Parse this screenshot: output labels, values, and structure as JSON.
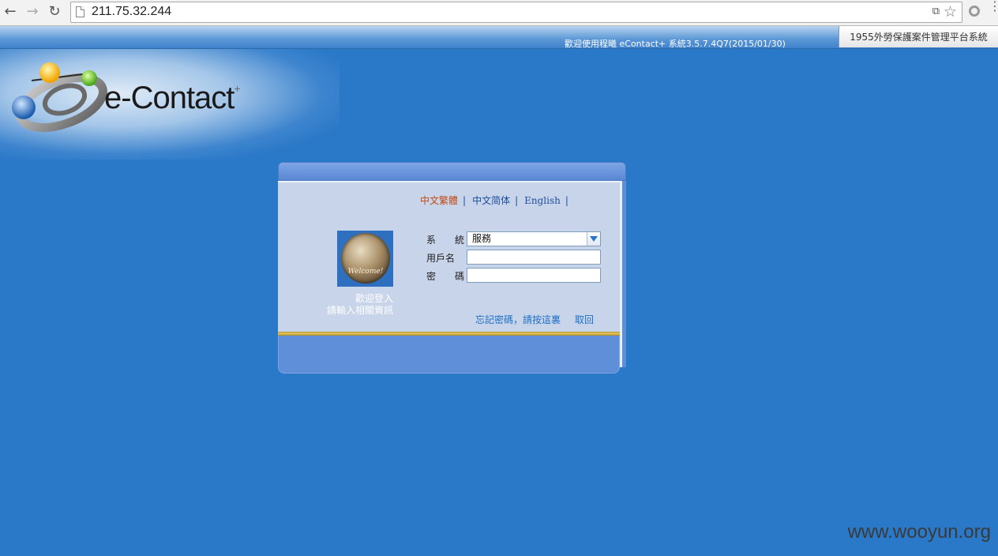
{
  "browser": {
    "url": "211.75.32.244",
    "back_glyph": "←",
    "forward_glyph": "→",
    "reload_glyph": "↻",
    "star_glyph": "☆",
    "menu_glyph": "⋮",
    "translate_glyph": "⧉"
  },
  "banner": {
    "welcome": "歡迎使用程曦 eContact+ 系統3.5.7.4Q7(2015/01/30)",
    "platform": "1955外勞保護案件管理平台系統"
  },
  "logo": {
    "text": "e-Contact",
    "plus": "+"
  },
  "login": {
    "languages": [
      {
        "label": "中文繁體",
        "active": true
      },
      {
        "label": "中文简体",
        "active": false
      },
      {
        "label": "English",
        "active": false
      }
    ],
    "separator": "|",
    "welcome_image_text": "Welcome!",
    "caption_line1": "歡迎登入",
    "caption_line2": "請輸入相關資訊",
    "system_label": "系　　統",
    "system_value": "服務",
    "username_label": "用戶名",
    "username_value": "",
    "password_label": "密　　碼",
    "password_value": "",
    "forgot_link": "忘記密碼，請按這裏",
    "cancel_link": "取回"
  },
  "watermark": "www.wooyun.org",
  "colors": {
    "page_bg": "#2a78c8",
    "active_lang": "#c24a0e",
    "lang": "#1d4f9c",
    "link": "#1d6fc4"
  }
}
